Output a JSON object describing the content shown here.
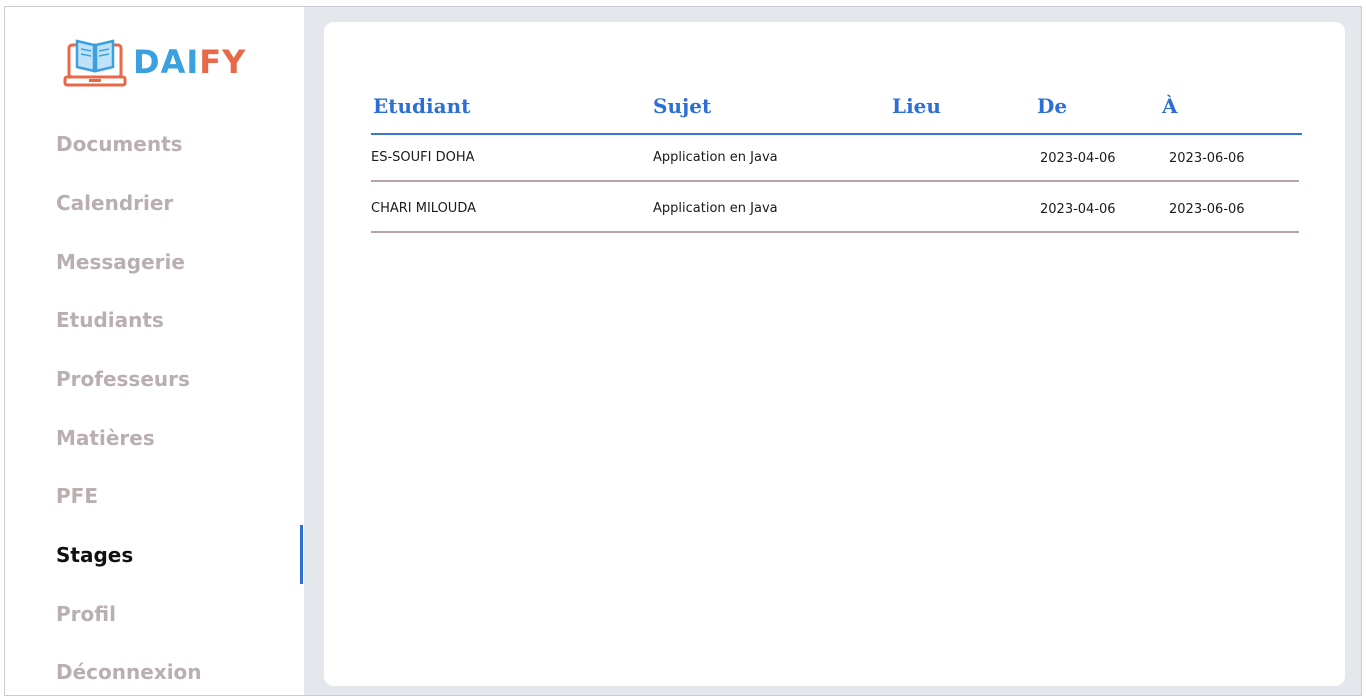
{
  "brand": {
    "part1": "DAI",
    "part2": "FY",
    "colors": {
      "primary": "#3aa0df",
      "accent": "#e8684a"
    }
  },
  "sidebar": {
    "items": [
      {
        "label": "Documents"
      },
      {
        "label": "Calendrier"
      },
      {
        "label": "Messagerie"
      },
      {
        "label": "Etudiants"
      },
      {
        "label": "Professeurs"
      },
      {
        "label": "Matières"
      },
      {
        "label": "PFE"
      },
      {
        "label": "Stages",
        "active": true
      },
      {
        "label": "Profil"
      },
      {
        "label": "Déconnexion"
      }
    ]
  },
  "table": {
    "headers": [
      "Etudiant",
      "Sujet",
      "Lieu",
      "De",
      "À"
    ],
    "rows": [
      [
        "ES-SOUFI DOHA",
        "Application en Java",
        "",
        "2023-04-06",
        "2023-06-06"
      ],
      [
        "CHARI MILOUDA",
        "Application en Java",
        "",
        "2023-04-06",
        "2023-06-06"
      ]
    ]
  },
  "colors": {
    "header_text": "#2d6fd6",
    "active_indicator": "#2f6fd3",
    "nav_inactive": "#b9aeb0"
  }
}
